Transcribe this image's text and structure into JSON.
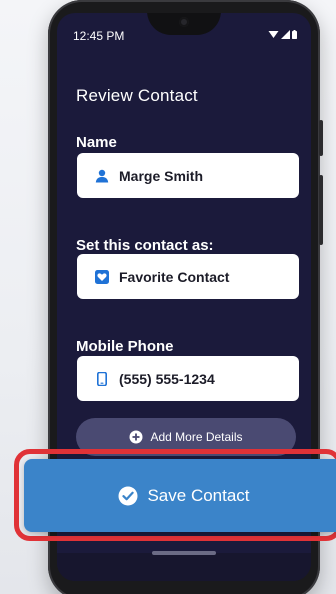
{
  "status_bar": {
    "time": "12:45 PM",
    "icons": [
      "wifi-icon",
      "signal-icon",
      "battery-icon"
    ]
  },
  "screen": {
    "title": "Review Contact",
    "name_section": {
      "label": "Name",
      "value": "Marge Smith",
      "icon": "person-icon"
    },
    "set_as_section": {
      "label": "Set this contact as:",
      "value": "Favorite Contact",
      "icon": "heart-icon"
    },
    "phone_section": {
      "label": "Mobile Phone",
      "value": "(555) 555-1234",
      "icon": "mobile-phone-icon"
    },
    "add_more_details": {
      "label": "Add More Details",
      "icon": "plus-circle-icon"
    }
  },
  "save_button": {
    "label": "Save Contact",
    "icon": "check-circle-icon"
  },
  "colors": {
    "screen_background": "#1b1a3b",
    "icon_blue": "#1f72d6",
    "save_button": "#3b84c9",
    "highlight": "#e03237",
    "add_details_button": "#4a4a72"
  }
}
